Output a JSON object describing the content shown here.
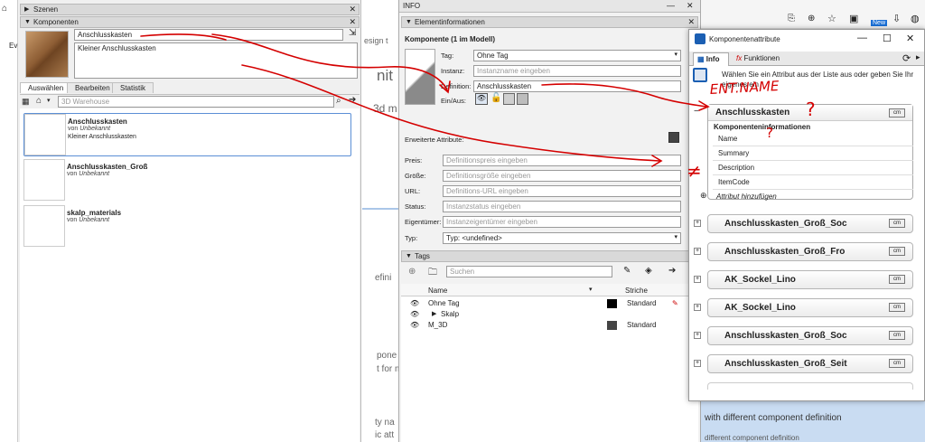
{
  "left": {
    "scenes_header": "Szenen",
    "components_header": "Komponenten",
    "name_value": "Anschlusskasten",
    "description_value": "Kleiner Anschlusskasten",
    "tabs": [
      "Auswählen",
      "Bearbeiten",
      "Statistik"
    ],
    "search_placeholder": "3D Warehouse",
    "items": [
      {
        "name": "Anschlusskasten",
        "by_prefix": "von",
        "author": "Unbekannt",
        "desc": "Kleiner Anschlusskasten"
      },
      {
        "name": "Anschlusskasten_Groß",
        "by_prefix": "von",
        "author": "Unbekannt",
        "desc": ""
      },
      {
        "name": "skalp_materials",
        "by_prefix": "von",
        "author": "Unbekannt",
        "desc": ""
      }
    ],
    "edge_fragments": [
      "Ev"
    ]
  },
  "backdrop": {
    "fragments": [
      "esign t",
      "nit",
      "3d m",
      "efini",
      "pone",
      "t for m",
      "ty na",
      "ic att"
    ]
  },
  "info": {
    "window_title": "INFO",
    "element_header": "Elementinformationen",
    "component_title": "Komponente (1 im Modell)",
    "tag_label": "Tag:",
    "tag_value": "Ohne Tag",
    "instance_label": "Instanz:",
    "instance_placeholder": "Instanzname eingeben",
    "definition_label": "Definition:",
    "definition_value": "Anschlusskasten",
    "toggle_label": "Ein/Aus:",
    "advanced_label": "Erweiterte Attribute:",
    "fields": [
      {
        "label": "Preis:",
        "placeholder": "Definitionspreis eingeben"
      },
      {
        "label": "Größe:",
        "placeholder": "Definitionsgröße eingeben"
      },
      {
        "label": "URL:",
        "placeholder": "Definitions-URL eingeben"
      },
      {
        "label": "Status:",
        "placeholder": "Instanzstatus eingeben"
      },
      {
        "label": "Eigentümer:",
        "placeholder": "Instanzeigentümer eingeben"
      }
    ],
    "type_label": "Typ:",
    "type_value": "Typ: <undefined>",
    "tags_header": "Tags",
    "tags_search_placeholder": "Suchen",
    "tags_col_name": "Name",
    "tags_col_dash": "Striche",
    "tags": [
      {
        "name": "Ohne Tag",
        "color": "#000000",
        "dash": "Standard",
        "indent": 0,
        "arrow": ""
      },
      {
        "name": "Skalp",
        "color": "",
        "dash": "",
        "indent": 1,
        "arrow": "▶"
      },
      {
        "name": "M_3D",
        "color": "#444444",
        "dash": "Standard",
        "indent": 0,
        "arrow": ""
      }
    ]
  },
  "right_bg": {
    "fragments": [
      "with different component definition",
      "different component definition"
    ],
    "browser_badge": "New"
  },
  "ca": {
    "title": "Komponentenattribute",
    "tab_info": "Info",
    "tab_functions": "Funktionen",
    "hint": "Wählen Sie ein Attribut aus der Liste aus oder geben Sie Ihr eigenes ein",
    "main_name": "Anschlusskasten",
    "section_title": "Komponenteninformationen",
    "attrs": [
      "Name",
      "Summary",
      "Description",
      "ItemCode"
    ],
    "add_attr": "Attribut hinzufügen",
    "cm_label": "cm",
    "rows": [
      "Anschlusskasten_Groß_Soc",
      "Anschlusskasten_Groß_Fro",
      "AK_Sockel_Lino",
      "AK_Sockel_Lino",
      "Anschlusskasten_Groß_Soc",
      "Anschlusskasten_Groß_Seit"
    ]
  },
  "annotations": {
    "ent_name": "ENT.NAME",
    "question": "?",
    "not_equal": "≠",
    "ink_color": "#d40000"
  }
}
